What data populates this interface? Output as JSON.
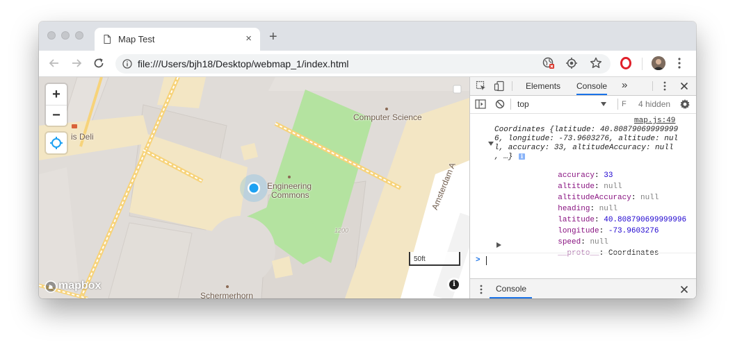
{
  "browser": {
    "tab_title": "Map Test",
    "tab_close": "×",
    "new_tab": "+",
    "url": "file:///Users/bjh18/Desktop/webmap_1/index.html"
  },
  "map": {
    "zoom_in": "+",
    "zoom_out": "−",
    "labels": {
      "computer_science": "Computer Science",
      "engineering_commons_1": "Engineering",
      "engineering_commons_2": "Commons",
      "deli": "is Deli",
      "amsterdam": "Amsterdam A",
      "schermerhorn": "Schermerhorn",
      "house_number": "1200"
    },
    "scale_label": "50ft",
    "logo": "mapbox",
    "info": "i",
    "colors": {
      "ground": "#e0dcd8",
      "building": "#f3e6c4",
      "park": "#b4e3a0",
      "road": "#f7d37a",
      "location_dot": "#1da1f2"
    }
  },
  "devtools": {
    "tabs": [
      "Elements",
      "Console"
    ],
    "more": "»",
    "context": "top",
    "filter": "F",
    "hidden": "4 hidden",
    "source": "map.js:49",
    "summary_line1": "Coordinates {latitude: 40.80879069999999",
    "summary_line2": "6, longitude: -73.9603276, altitude: nul",
    "summary_line3": "l, accuracy: 33, altitudeAccuracy: null",
    "summary_line4": ", …}",
    "info_badge": "i",
    "props": [
      {
        "name": "accuracy",
        "value": "33",
        "kind": "num"
      },
      {
        "name": "altitude",
        "value": "null",
        "kind": "null"
      },
      {
        "name": "altitudeAccuracy",
        "value": "null",
        "kind": "null"
      },
      {
        "name": "heading",
        "value": "null",
        "kind": "null"
      },
      {
        "name": "latitude",
        "value": "40.808790699999996",
        "kind": "num"
      },
      {
        "name": "longitude",
        "value": "-73.9603276",
        "kind": "num"
      },
      {
        "name": "speed",
        "value": "null",
        "kind": "null"
      }
    ],
    "proto_name": "__proto__",
    "proto_value": "Coordinates",
    "prompt": ">",
    "drawer_title": "Console",
    "drawer_close": "×"
  }
}
